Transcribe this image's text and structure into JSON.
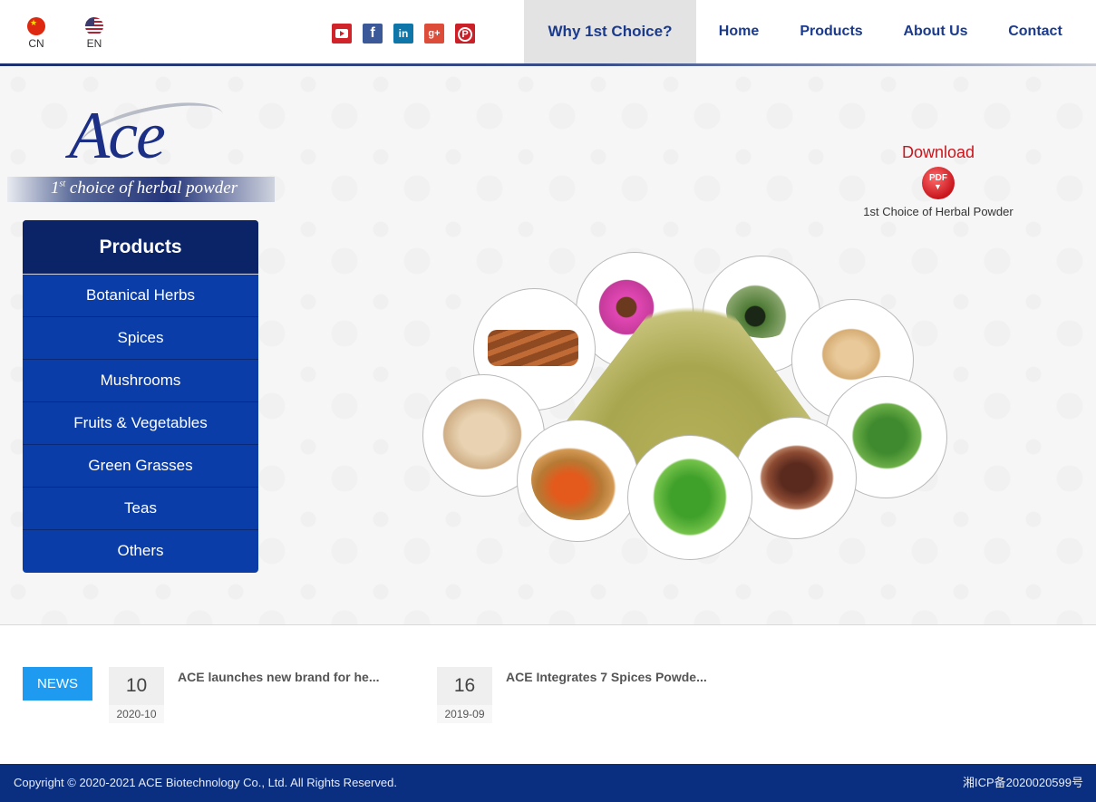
{
  "header": {
    "languages": [
      {
        "code": "CN",
        "flag": "china-flag-icon"
      },
      {
        "code": "EN",
        "flag": "usa-flag-icon"
      }
    ],
    "social": [
      {
        "name": "youtube-icon",
        "color": "#d0232a"
      },
      {
        "name": "facebook-icon",
        "color": "#3b5998",
        "glyph": "f"
      },
      {
        "name": "linkedin-icon",
        "color": "#0e76a8",
        "glyph": "in"
      },
      {
        "name": "google-plus-icon",
        "color": "#dd4b39",
        "glyph": "g+"
      },
      {
        "name": "pinterest-icon",
        "color": "#cb2027",
        "glyph": "P"
      }
    ],
    "nav": {
      "why": "Why 1st Choice?",
      "home": "Home",
      "products": "Products",
      "about": "About Us",
      "contact": "Contact"
    }
  },
  "logo": {
    "brand": "Ace",
    "tagline_prefix": "1",
    "tagline_sup": "st",
    "tagline_rest": " choice of herbal powder"
  },
  "sidebar": {
    "title": "Products",
    "items": [
      {
        "label": "Botanical Herbs"
      },
      {
        "label": "Spices"
      },
      {
        "label": "Mushrooms"
      },
      {
        "label": "Fruits & Vegetables"
      },
      {
        "label": "Green Grasses"
      },
      {
        "label": "Teas"
      },
      {
        "label": "Others"
      }
    ]
  },
  "download": {
    "title": "Download",
    "icon_label": "PDF",
    "subtitle": "1st Choice of Herbal Powder"
  },
  "news": {
    "badge": "NEWS",
    "items": [
      {
        "day": "10",
        "month": "2020-10",
        "title": "ACE launches new brand for he..."
      },
      {
        "day": "16",
        "month": "2019-09",
        "title": "ACE Integrates 7 Spices Powde..."
      }
    ]
  },
  "footer": {
    "copyright": "Copyright © 2020-2021 ACE Biotechnology Co., Ltd. All Rights Reserved.",
    "icp": "湘ICP备2020020599号"
  },
  "colors": {
    "nav_text": "#1a3a8e",
    "sidebar_header": "#0b2468",
    "sidebar_body": "#0b3da8",
    "news_badge": "#1e9af0",
    "footer": "#0b2f80",
    "download": "#c8161d"
  }
}
